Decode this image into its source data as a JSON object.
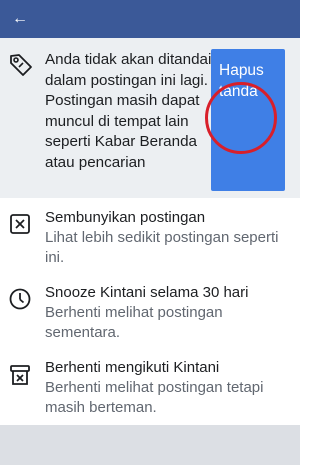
{
  "header": {
    "back_glyph": "←"
  },
  "notice": {
    "text": "Anda tidak akan ditandai dalam postingan ini lagi. Postingan masih dapat muncul di tempat lain seperti Kabar Beranda atau pencarian",
    "untag_button": "Hapus tanda",
    "icon": "tag-icon"
  },
  "options": [
    {
      "title": "Sembunyikan postingan",
      "subtitle": "Lihat lebih sedikit postingan seperti ini.",
      "icon": "hide-post-icon"
    },
    {
      "title": "Snooze Kintani selama 30 hari",
      "subtitle": "Berhenti melihat postingan sementara.",
      "icon": "clock-icon"
    },
    {
      "title": "Berhenti mengikuti Kintani",
      "subtitle": "Berhenti melihat postingan tetapi masih berteman.",
      "icon": "unfollow-icon"
    }
  ],
  "colors": {
    "header_bg": "#3b5998",
    "button_bg": "#3f7fe6",
    "annotation_circle": "#d81f2a"
  }
}
